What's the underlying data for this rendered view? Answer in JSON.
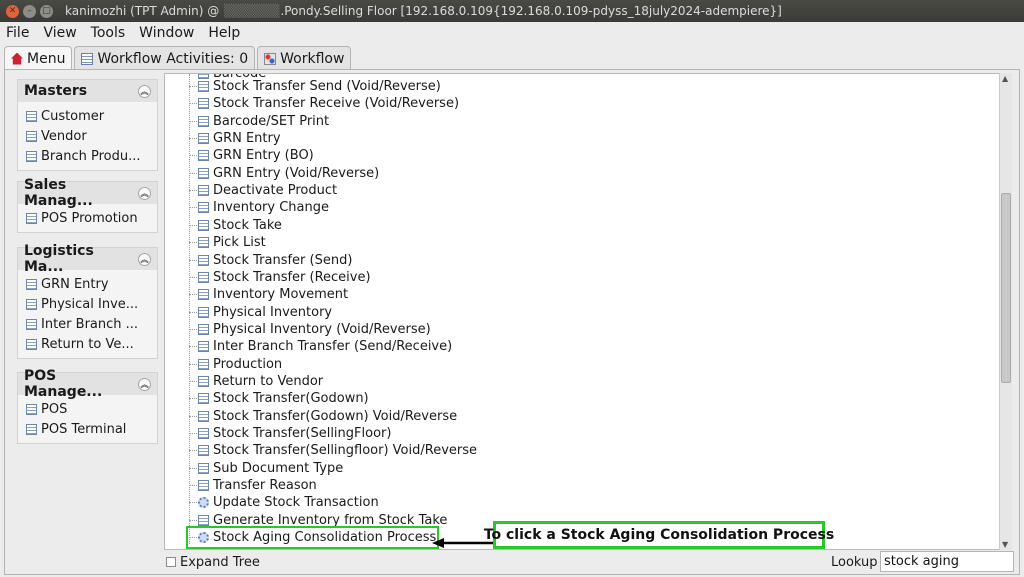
{
  "window": {
    "title_prefix": "kanimozhi (TPT Admin) @",
    "title_suffix": ".Pondy.Selling Floor [192.168.0.109{192.168.0.109-pdyss_18july2024-adempiere}]",
    "controls": [
      "close",
      "minimize",
      "maximize"
    ]
  },
  "menubar": {
    "file": "File",
    "view": "View",
    "tools": "Tools",
    "window": "Window",
    "help": "Help"
  },
  "tabs": [
    {
      "label": "Menu",
      "icon": "home-icon"
    },
    {
      "label": "Workflow Activities: 0",
      "icon": "table-icon"
    },
    {
      "label": "Workflow",
      "icon": "workflow-icon"
    }
  ],
  "sidebar": {
    "groups": [
      {
        "title": "Masters",
        "items": [
          "Customer",
          "Vendor",
          "Branch Produ..."
        ]
      },
      {
        "title": "Sales Manag...",
        "items": [
          "POS Promotion"
        ]
      },
      {
        "title": "Logistics Ma...",
        "items": [
          "GRN Entry",
          "Physical Inve...",
          "Inter Branch ...",
          "Return to Ve..."
        ]
      },
      {
        "title": "POS Manage...",
        "items": [
          "POS",
          "POS Terminal"
        ]
      }
    ]
  },
  "tree": {
    "partial_top_item": "Barcode",
    "items": [
      {
        "label": "Stock Transfer Send (Void/Reverse)",
        "icon": "document-icon"
      },
      {
        "label": "Stock Transfer Receive (Void/Reverse)",
        "icon": "document-icon"
      },
      {
        "label": "Barcode/SET Print",
        "icon": "document-icon"
      },
      {
        "label": "GRN Entry",
        "icon": "document-icon"
      },
      {
        "label": "GRN Entry (BO)",
        "icon": "document-icon"
      },
      {
        "label": "GRN Entry (Void/Reverse)",
        "icon": "document-icon"
      },
      {
        "label": "Deactivate Product",
        "icon": "document-icon"
      },
      {
        "label": "Inventory Change",
        "icon": "document-icon"
      },
      {
        "label": "Stock Take",
        "icon": "document-icon"
      },
      {
        "label": "Pick List",
        "icon": "document-icon"
      },
      {
        "label": "Stock Transfer (Send)",
        "icon": "document-icon"
      },
      {
        "label": "Stock Transfer (Receive)",
        "icon": "document-icon"
      },
      {
        "label": "Inventory Movement",
        "icon": "document-icon"
      },
      {
        "label": "Physical Inventory",
        "icon": "document-icon"
      },
      {
        "label": "Physical Inventory (Void/Reverse)",
        "icon": "document-icon"
      },
      {
        "label": "Inter Branch Transfer (Send/Receive)",
        "icon": "document-icon"
      },
      {
        "label": "Production",
        "icon": "document-icon"
      },
      {
        "label": "Return to Vendor",
        "icon": "document-icon"
      },
      {
        "label": "Stock Transfer(Godown)",
        "icon": "document-icon"
      },
      {
        "label": "Stock Transfer(Godown) Void/Reverse",
        "icon": "document-icon"
      },
      {
        "label": "Stock Transfer(SellingFloor)",
        "icon": "document-icon"
      },
      {
        "label": "Stock Transfer(Sellingfloor) Void/Reverse",
        "icon": "document-icon"
      },
      {
        "label": "Sub Document Type",
        "icon": "document-icon"
      },
      {
        "label": "Transfer Reason",
        "icon": "document-icon"
      },
      {
        "label": "Update Stock Transaction",
        "icon": "gear-icon"
      },
      {
        "label": "Generate Inventory from Stock Take",
        "icon": "document-icon"
      },
      {
        "label": "Stock Aging Consolidation Process",
        "icon": "gear-icon",
        "highlighted": true
      }
    ]
  },
  "annotation": {
    "text": "To click a Stock Aging Consolidation Process",
    "color": "#28c828"
  },
  "bottom": {
    "expand_tree_label": "Expand Tree",
    "lookup_label": "Lookup",
    "lookup_value": "stock aging"
  },
  "colors": {
    "highlight": "#28c828",
    "titlebar": "#3f3f3b",
    "close_button": "#e0633a"
  }
}
